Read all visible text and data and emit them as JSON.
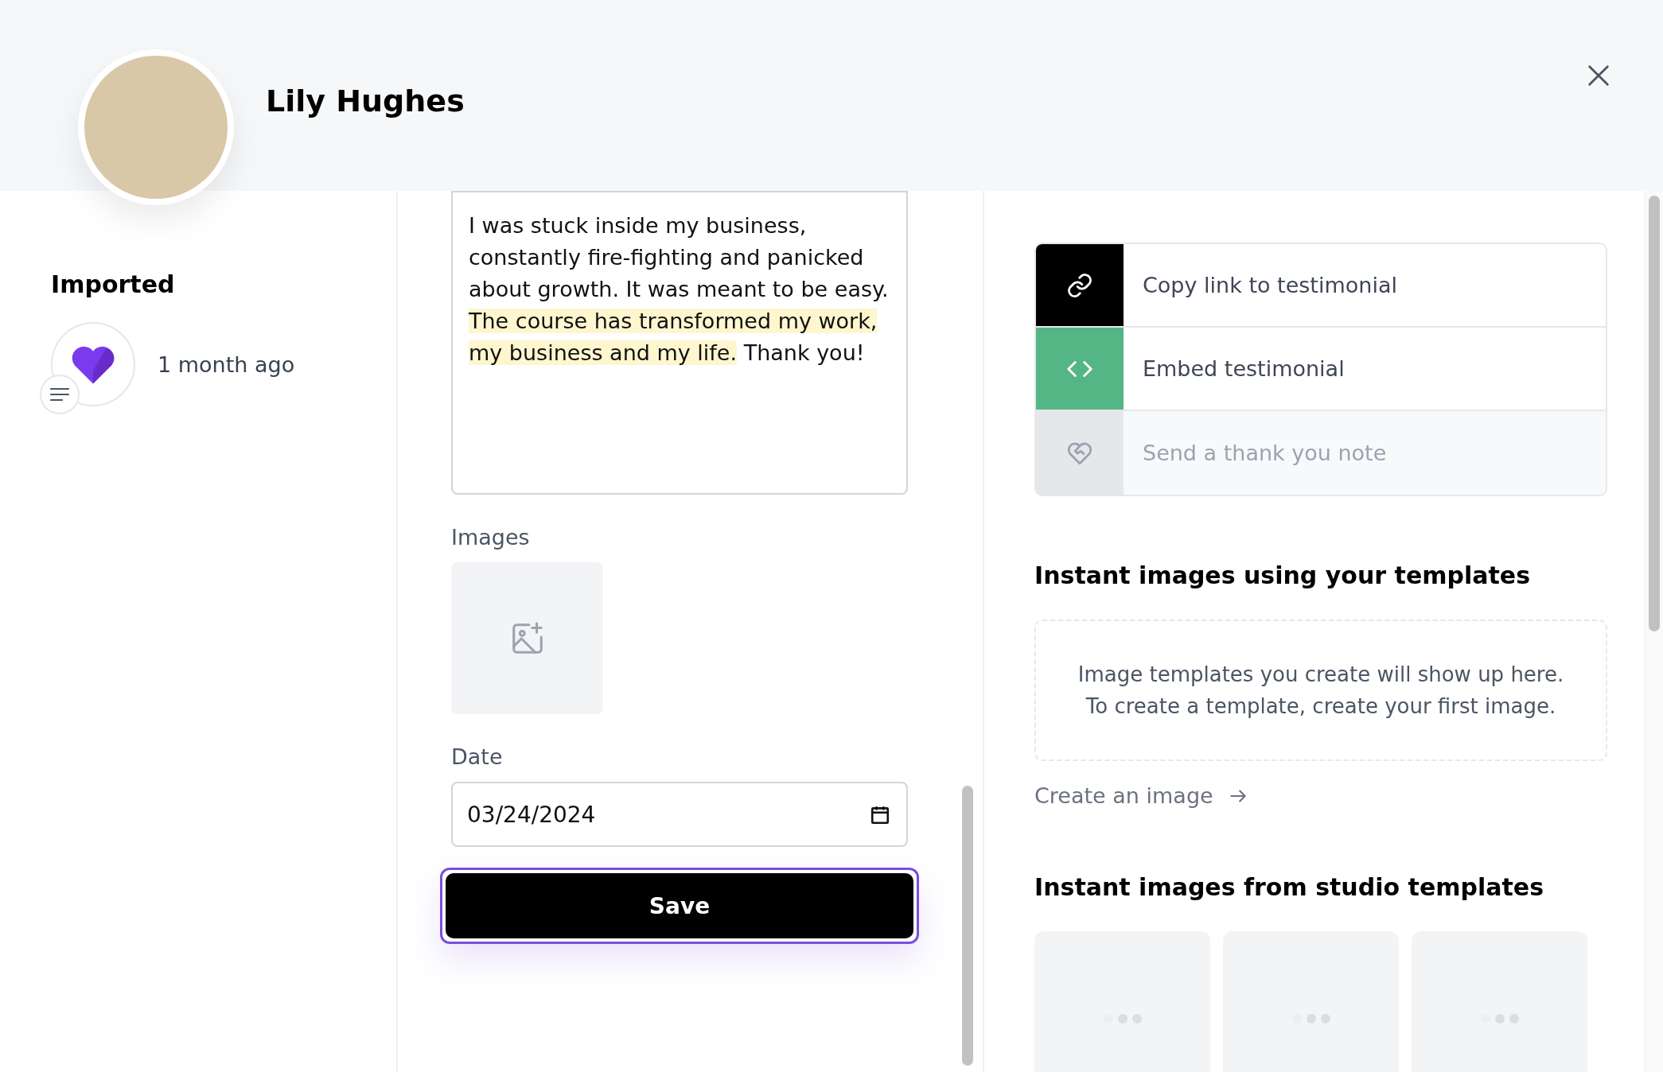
{
  "header": {
    "name": "Lily Hughes"
  },
  "sidebar": {
    "source": "Imported",
    "time": "1 month ago"
  },
  "editor": {
    "segments": [
      {
        "text": "I was stuck inside my business, constantly fire-fighting and panicked about growth. It was meant to be easy.",
        "highlighted": false
      },
      {
        "text": " The course has transformed my work, my business and my life.",
        "highlighted": true
      },
      {
        "text": " Thank you!",
        "highlighted": false
      }
    ],
    "images_label": "Images",
    "date_label": "Date",
    "date_value": "03/24/2024",
    "save_label": "Save"
  },
  "actions": [
    {
      "kind": "link",
      "label": "Copy link to testimonial",
      "color": "#000000",
      "disabled": false
    },
    {
      "kind": "embed",
      "label": "Embed testimonial",
      "color": "#55b685",
      "disabled": false
    },
    {
      "kind": "thanks",
      "label": "Send a thank you note",
      "color": "#e5e7eb",
      "disabled": true
    }
  ],
  "templates": {
    "title": "Instant images using your templates",
    "empty_text": "Image templates you create will show up here. To create a template, create your first image.",
    "create_link": "Create an image"
  },
  "studio": {
    "title": "Instant images from studio templates",
    "cards": [
      {
        "loading": true
      },
      {
        "loading": true
      },
      {
        "loading": true
      }
    ]
  }
}
